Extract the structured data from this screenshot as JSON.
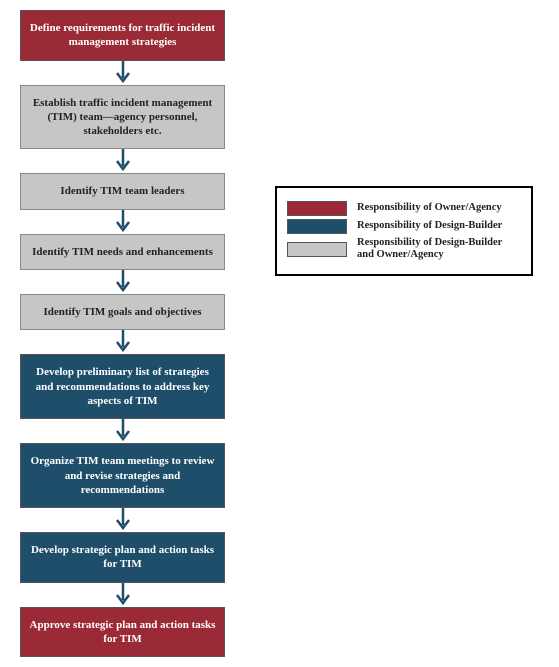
{
  "steps": [
    {
      "role": "owner",
      "text": "Define requirements for traffic incident management strategies"
    },
    {
      "role": "shared",
      "text": "Establish traffic incident management (TIM) team—agency personnel, stakeholders etc."
    },
    {
      "role": "shared",
      "text": "Identify TIM team leaders"
    },
    {
      "role": "shared",
      "text": "Identify TIM needs and enhancements"
    },
    {
      "role": "shared",
      "text": "Identify TIM goals and objectives"
    },
    {
      "role": "design",
      "text": "Develop preliminary list of strategies and recommendations to address key aspects of TIM"
    },
    {
      "role": "design",
      "text": "Organize TIM team meetings to review and revise strategies and recommendations"
    },
    {
      "role": "design",
      "text": "Develop strategic plan and action tasks for TIM"
    },
    {
      "role": "owner",
      "text": "Approve strategic plan and action tasks for TIM"
    }
  ],
  "legend": {
    "owner": "Responsibility of Owner/Agency",
    "design": "Responsibility of Design-Builder",
    "shared": "Responsibility of Design-Builder and Owner/Agency"
  },
  "colors": {
    "owner": "#9a2a36",
    "design": "#1f4e6b",
    "shared": "#c6c6c6",
    "arrow": "#1f4e6b"
  }
}
